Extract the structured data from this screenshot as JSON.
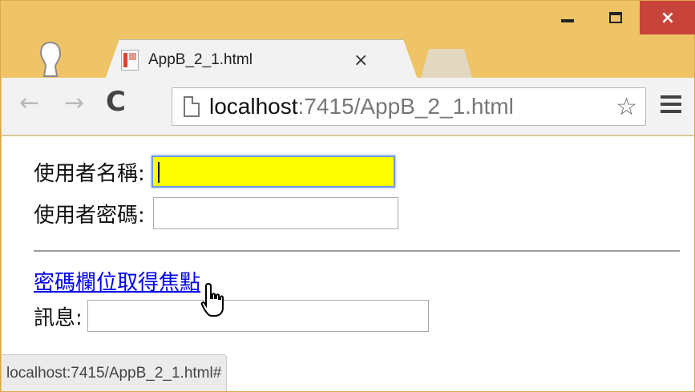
{
  "window": {
    "controls": {
      "minimize": "minimize",
      "maximize": "maximize",
      "close": "×"
    }
  },
  "tab": {
    "title": "AppB_2_1.html",
    "close": "×"
  },
  "toolbar": {
    "back": "←",
    "forward": "→",
    "reload": "C",
    "url_host": "localhost",
    "url_rest": ":7415/AppB_2_1.html",
    "star": "☆"
  },
  "form": {
    "username_label": "使用者名稱:",
    "username_value": "",
    "password_label": "使用者密碼:",
    "password_value": "",
    "focus_link": "密碼欄位取得焦點",
    "message_label": "訊息:",
    "message_value": ""
  },
  "status_bar": {
    "text": "localhost:7415/AppB_2_1.html#"
  },
  "colors": {
    "focused_field": "#ffff00",
    "link": "#0000ee",
    "frame": "#efc467",
    "close_button": "#c8443a"
  },
  "icons": [
    "profile-icon",
    "page-favicon-icon",
    "back-arrow-icon",
    "forward-arrow-icon",
    "reload-icon",
    "page-icon",
    "star-icon",
    "menu-icon",
    "hand-cursor-icon"
  ]
}
